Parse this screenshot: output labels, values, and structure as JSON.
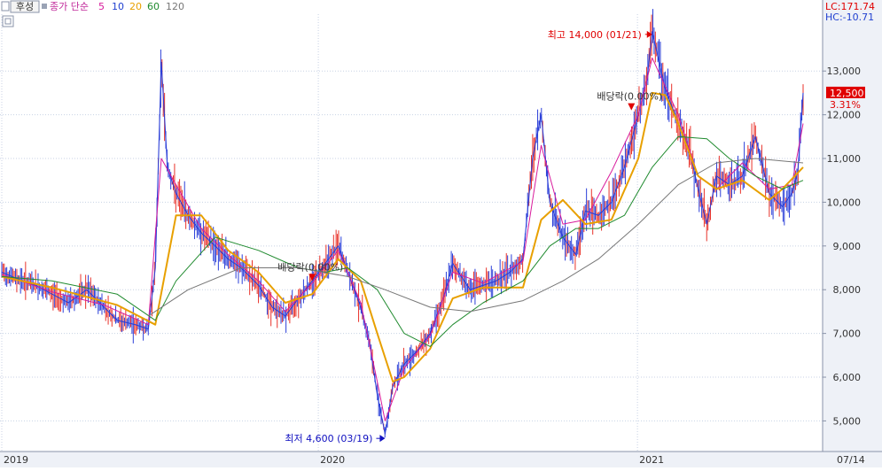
{
  "toolbar": {
    "mode_label": "후성",
    "legend_prefix": "종가 단순",
    "ma_periods": [
      "5",
      "10",
      "20",
      "60",
      "120"
    ]
  },
  "right_info": {
    "lc": "LC:171.74",
    "hc": "HC:-10.71"
  },
  "colors": {
    "price": "#2b3fd8",
    "up_candle": "#e8322a",
    "ma5": "#d81b9c",
    "ma10": "#1f3fd0",
    "ma20": "#e8a000",
    "ma60": "#1f8a2e",
    "ma120": "#777777",
    "grid": "#c8d2e4",
    "axis_bg": "#eef1f7",
    "annot_red": "#e00000",
    "annot_blue": "#1010c0"
  },
  "chart_data": {
    "type": "line",
    "x_range": [
      "2019-01-02",
      "2021-07-14"
    ],
    "x_ticks": [
      {
        "date": "2019-01-02",
        "label": "2019"
      },
      {
        "date": "2020-01-02",
        "label": "2020"
      },
      {
        "date": "2021-01-04",
        "label": "2021"
      },
      {
        "date": "2021-07-14",
        "label": "07/14"
      }
    ],
    "ylim": [
      4300,
      14300
    ],
    "y_ticks": [
      5000,
      6000,
      7000,
      8000,
      9000,
      10000,
      11000,
      12000,
      13000
    ],
    "y_tick_labels": [
      "5,000",
      "6,000",
      "7,000",
      "8,000",
      "9,000",
      "10,000",
      "11,000",
      "12,000",
      "13,000"
    ],
    "current_price": {
      "value": 12500,
      "label": "12,500",
      "change": "3.31%"
    },
    "annotations": [
      {
        "id": "high",
        "text": "최고 14,000 (01/21)",
        "date": "2021-01-21",
        "value": 14000,
        "color": "red"
      },
      {
        "id": "low",
        "text": "최저 4,600 (03/19)",
        "date": "2020-03-19",
        "value": 4600,
        "color": "blue"
      },
      {
        "id": "div1",
        "text": "배당락(0.00%)",
        "date": "2019-12-26",
        "value": 8200,
        "color": "red"
      },
      {
        "id": "div2",
        "text": "배당락(0.00%)",
        "date": "2020-12-28",
        "value": 12100,
        "color": "red"
      }
    ],
    "series": [
      {
        "name": "종가",
        "x": [
          "2019-01-02",
          "2019-01-20",
          "2019-02-10",
          "2019-03-01",
          "2019-03-20",
          "2019-04-10",
          "2019-04-30",
          "2019-05-15",
          "2019-06-05",
          "2019-06-20",
          "2019-06-28",
          "2019-07-05",
          "2019-07-12",
          "2019-07-22",
          "2019-08-05",
          "2019-08-20",
          "2019-09-05",
          "2019-09-20",
          "2019-10-05",
          "2019-10-25",
          "2019-11-10",
          "2019-11-25",
          "2019-12-10",
          "2019-12-26",
          "2020-01-10",
          "2020-01-25",
          "2020-02-05",
          "2020-02-20",
          "2020-03-01",
          "2020-03-10",
          "2020-03-19",
          "2020-03-28",
          "2020-04-10",
          "2020-04-25",
          "2020-05-10",
          "2020-05-25",
          "2020-06-05",
          "2020-06-15",
          "2020-06-25",
          "2020-07-10",
          "2020-07-25",
          "2020-08-10",
          "2020-08-25",
          "2020-09-05",
          "2020-09-15",
          "2020-09-25",
          "2020-10-10",
          "2020-10-25",
          "2020-11-05",
          "2020-11-20",
          "2020-12-05",
          "2020-12-20",
          "2021-01-05",
          "2021-01-15",
          "2021-01-21",
          "2021-02-05",
          "2021-02-20",
          "2021-03-05",
          "2021-03-15",
          "2021-03-25",
          "2021-04-05",
          "2021-04-20",
          "2021-05-05",
          "2021-05-20",
          "2021-06-05",
          "2021-06-20",
          "2021-07-01",
          "2021-07-08",
          "2021-07-14"
        ],
        "values": [
          8400,
          8250,
          8100,
          7900,
          7700,
          8000,
          7600,
          7300,
          7200,
          7100,
          8500,
          13200,
          10800,
          10200,
          9700,
          9300,
          9000,
          8700,
          8500,
          8100,
          7600,
          7400,
          7800,
          8200,
          8600,
          9000,
          8400,
          7600,
          6800,
          5600,
          4700,
          5800,
          6300,
          6600,
          7000,
          7800,
          8600,
          8300,
          8000,
          8100,
          8200,
          8400,
          8700,
          11000,
          12000,
          10000,
          9200,
          8800,
          9800,
          9700,
          10000,
          10800,
          12000,
          12800,
          13900,
          12600,
          11800,
          11200,
          10300,
          9500,
          10600,
          10400,
          10600,
          11500,
          10200,
          9900,
          10200,
          10700,
          12500
        ]
      },
      {
        "name": "5",
        "x": [
          "2019-01-02",
          "2019-03-01",
          "2019-04-30",
          "2019-06-20",
          "2019-07-05",
          "2019-07-22",
          "2019-08-20",
          "2019-09-20",
          "2019-10-25",
          "2019-11-25",
          "2019-12-26",
          "2020-01-25",
          "2020-02-20",
          "2020-03-10",
          "2020-03-19",
          "2020-04-10",
          "2020-05-10",
          "2020-06-05",
          "2020-07-10",
          "2020-08-25",
          "2020-09-15",
          "2020-10-10",
          "2020-11-05",
          "2020-12-05",
          "2021-01-05",
          "2021-01-21",
          "2021-02-20",
          "2021-03-15",
          "2021-04-05",
          "2021-05-05",
          "2021-06-05",
          "2021-07-01",
          "2021-07-14"
        ],
        "values": [
          8350,
          7950,
          7650,
          7200,
          11000,
          10400,
          9400,
          8800,
          8200,
          7500,
          8150,
          8900,
          7700,
          5900,
          5000,
          6200,
          6950,
          8400,
          8150,
          8650,
          11300,
          9500,
          9600,
          10700,
          12000,
          13300,
          12000,
          10600,
          10300,
          10900,
          10300,
          10400,
          11800
        ]
      },
      {
        "name": "20",
        "x": [
          "2019-01-02",
          "2019-03-01",
          "2019-05-15",
          "2019-06-28",
          "2019-07-22",
          "2019-08-20",
          "2019-09-20",
          "2019-10-25",
          "2019-11-25",
          "2019-12-26",
          "2020-01-25",
          "2020-02-20",
          "2020-03-10",
          "2020-03-28",
          "2020-04-10",
          "2020-05-10",
          "2020-06-05",
          "2020-07-10",
          "2020-08-25",
          "2020-09-15",
          "2020-10-10",
          "2020-11-05",
          "2020-12-05",
          "2021-01-05",
          "2021-01-21",
          "2021-02-05",
          "2021-02-20",
          "2021-03-15",
          "2021-04-05",
          "2021-05-05",
          "2021-06-05",
          "2021-06-20",
          "2021-07-14"
        ],
        "values": [
          8300,
          8050,
          7650,
          7200,
          9700,
          9700,
          8900,
          8400,
          7700,
          7900,
          8700,
          8200,
          7000,
          5900,
          6000,
          6650,
          7800,
          8050,
          8050,
          9600,
          10050,
          9500,
          9600,
          11000,
          12500,
          12450,
          11800,
          10600,
          10300,
          10500,
          10050,
          10300,
          10800
        ]
      },
      {
        "name": "60",
        "x": [
          "2019-01-02",
          "2019-03-01",
          "2019-05-15",
          "2019-06-28",
          "2019-07-22",
          "2019-09-05",
          "2019-10-25",
          "2019-12-10",
          "2020-01-10",
          "2020-02-05",
          "2020-03-10",
          "2020-04-10",
          "2020-05-10",
          "2020-06-05",
          "2020-07-10",
          "2020-08-25",
          "2020-09-25",
          "2020-10-25",
          "2020-11-20",
          "2020-12-20",
          "2021-01-21",
          "2021-02-20",
          "2021-03-25",
          "2021-04-20",
          "2021-05-20",
          "2021-06-20",
          "2021-07-14"
        ],
        "values": [
          8300,
          8200,
          7900,
          7300,
          8200,
          9200,
          8900,
          8500,
          8400,
          8500,
          8000,
          7000,
          6700,
          7200,
          7700,
          8200,
          9000,
          9400,
          9400,
          9700,
          10800,
          11500,
          11450,
          11000,
          10600,
          10300,
          10500
        ]
      },
      {
        "name": "120",
        "x": [
          "2019-06-20",
          "2019-08-05",
          "2019-10-05",
          "2019-12-10",
          "2020-02-05",
          "2020-03-19",
          "2020-05-10",
          "2020-06-25",
          "2020-08-25",
          "2020-10-10",
          "2020-11-20",
          "2021-01-05",
          "2021-02-20",
          "2021-04-05",
          "2021-05-20",
          "2021-07-14"
        ],
        "values": [
          7400,
          8000,
          8500,
          8500,
          8300,
          8000,
          7600,
          7500,
          7750,
          8200,
          8700,
          9500,
          10400,
          10900,
          11000,
          10900
        ]
      }
    ]
  }
}
